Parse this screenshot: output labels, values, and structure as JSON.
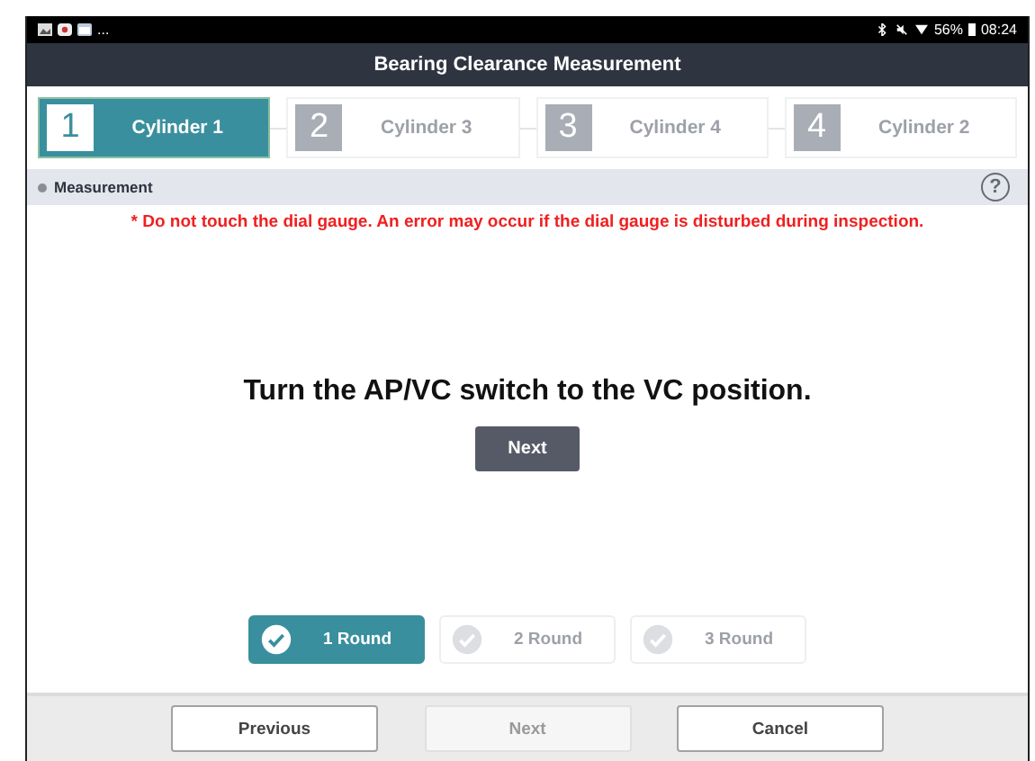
{
  "status_bar": {
    "notifications": "...",
    "battery": "56%",
    "time": "08:24"
  },
  "window": {
    "title": "Bearing Clearance Measurement"
  },
  "steps": [
    {
      "number": "1",
      "label": "Cylinder 1",
      "selected": true
    },
    {
      "number": "2",
      "label": "Cylinder 3",
      "selected": false
    },
    {
      "number": "3",
      "label": "Cylinder 4",
      "selected": false
    },
    {
      "number": "4",
      "label": "Cylinder 2",
      "selected": false
    }
  ],
  "section": {
    "title": "Measurement",
    "help": "?"
  },
  "warning": "* Do not touch the dial gauge. An error may occur if the dial gauge is disturbed during inspection.",
  "instruction": "Turn the AP/VC switch to the VC position.",
  "next_button": {
    "label": "Next",
    "disabled": false
  },
  "rounds": [
    {
      "label": "1 Round",
      "selected": true
    },
    {
      "label": "2 Round",
      "selected": false
    },
    {
      "label": "3 Round",
      "selected": false
    }
  ],
  "footer": [
    {
      "label": "Previous",
      "disabled": false
    },
    {
      "label": "Next",
      "disabled": true
    },
    {
      "label": "Cancel",
      "disabled": false
    }
  ]
}
